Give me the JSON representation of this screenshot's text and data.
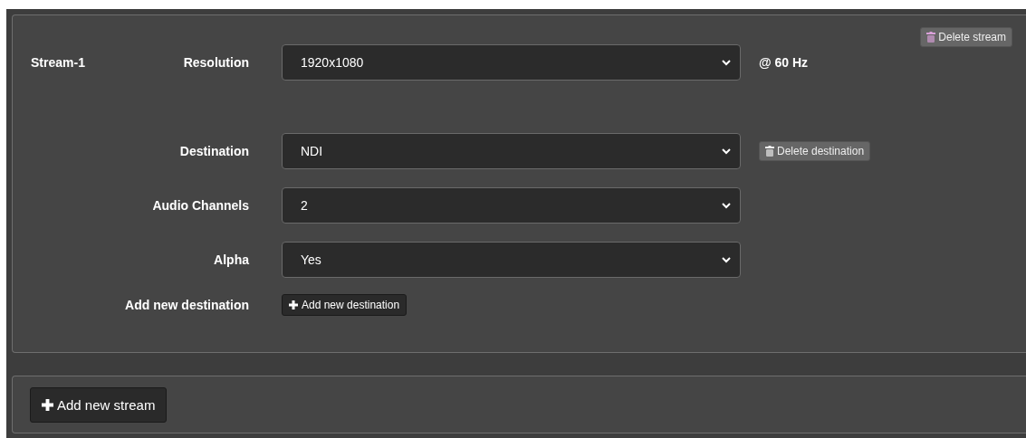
{
  "stream": {
    "name": "Stream-1",
    "delete_button": "Delete stream",
    "resolution": {
      "label": "Resolution",
      "value": "1920x1080",
      "rate": "@ 60 Hz"
    },
    "destination": {
      "label": "Destination",
      "value": "NDI",
      "delete_button": "Delete destination"
    },
    "fields": [
      {
        "label": "Audio Channels",
        "value": "2"
      },
      {
        "label": "Alpha",
        "value": "Yes"
      }
    ],
    "add_destination": {
      "label": "Add new destination",
      "button": "Add new destination"
    }
  },
  "add_stream_button": "Add new stream"
}
